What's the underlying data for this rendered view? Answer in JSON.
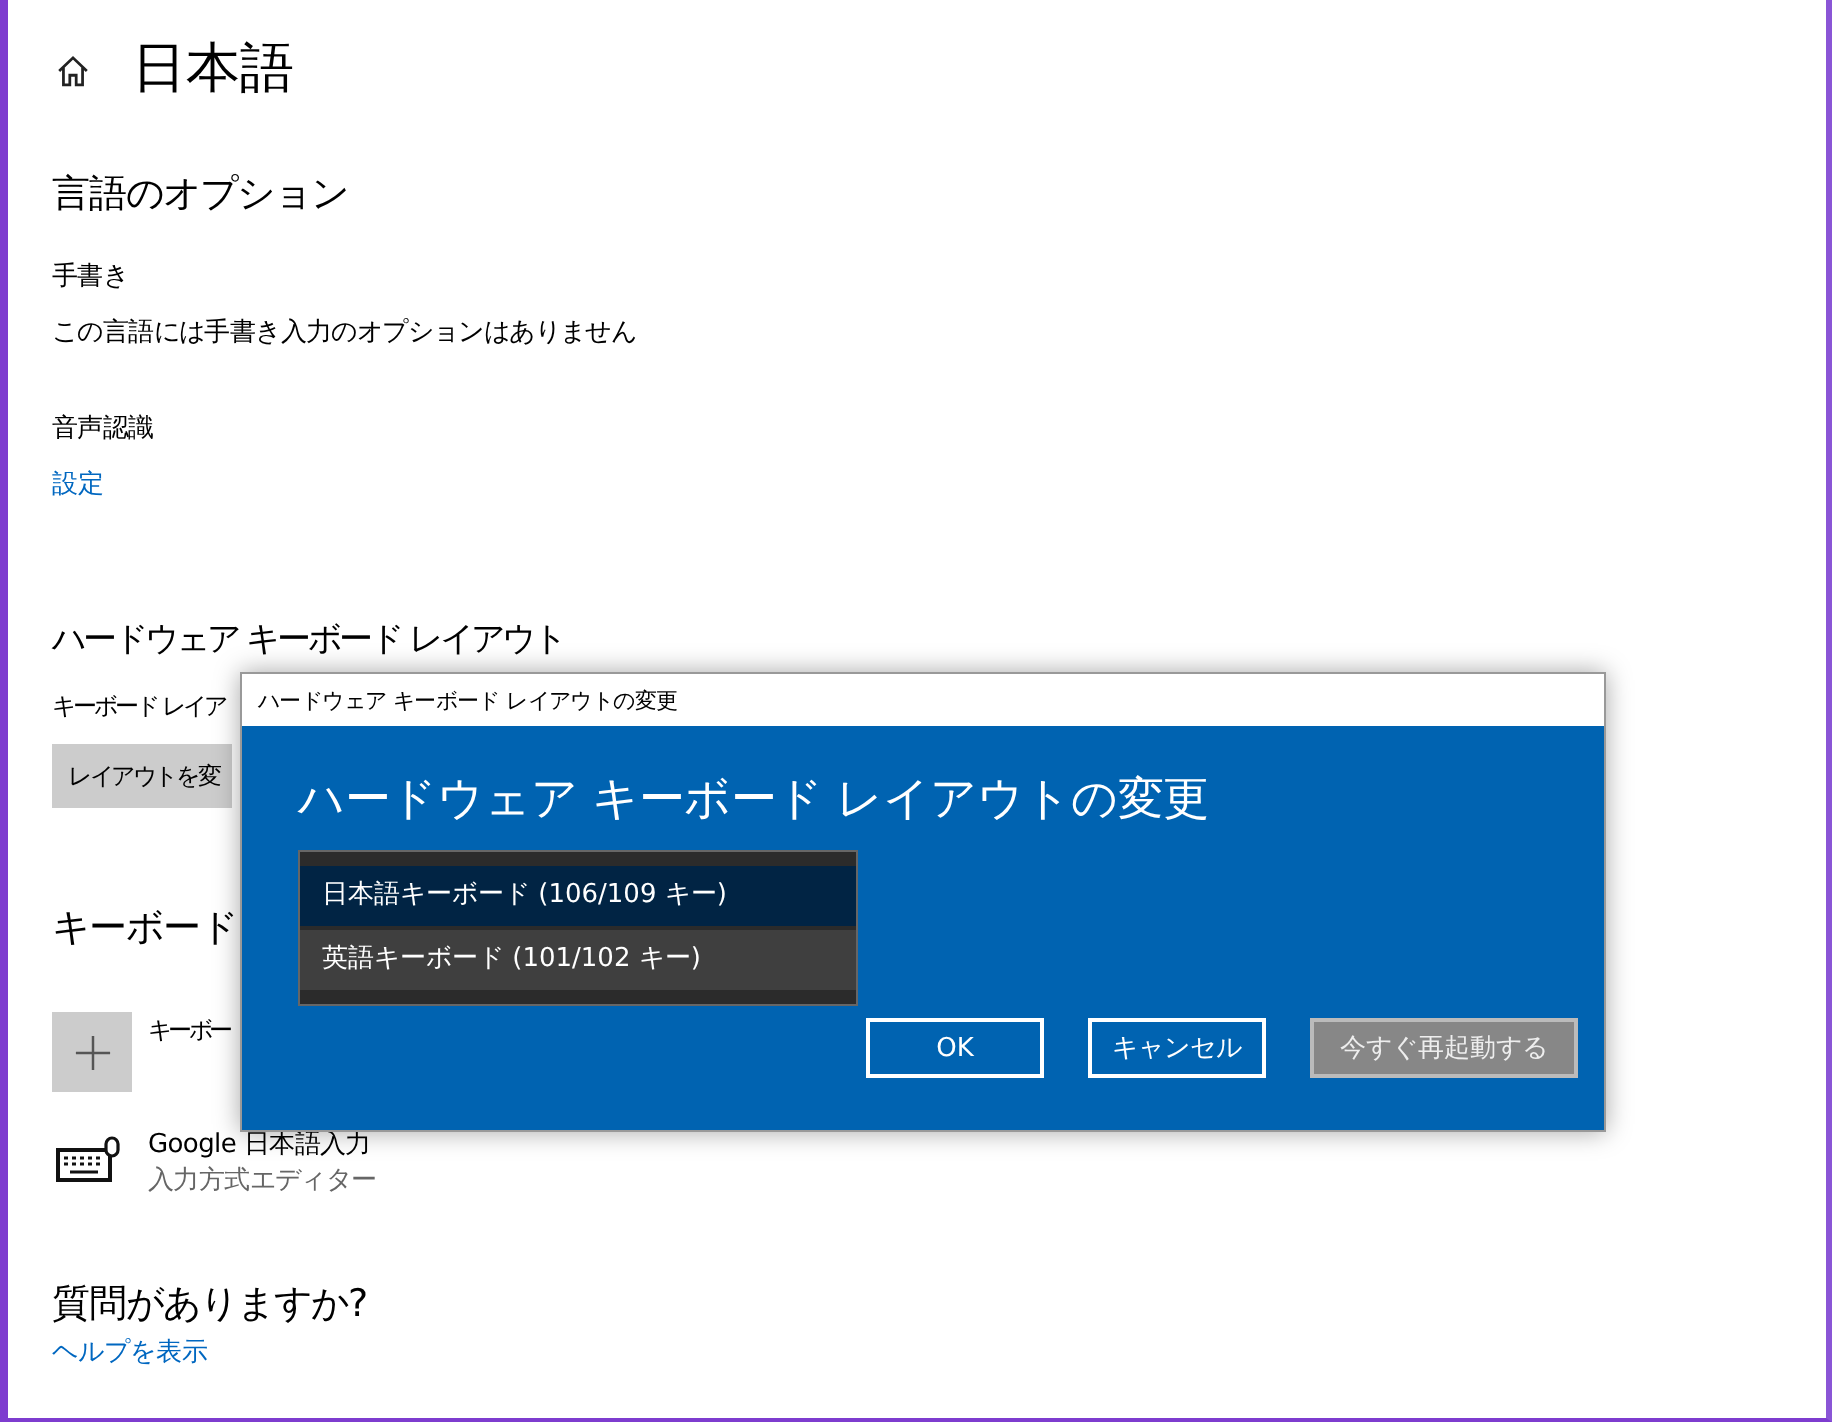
{
  "page": {
    "title": "日本語"
  },
  "language_options": {
    "heading": "言語のオプション",
    "handwriting": {
      "label": "手書き",
      "text": "この言語には手書き入力のオプションはありません"
    },
    "speech": {
      "label": "音声認識",
      "link": "設定"
    }
  },
  "hardware_keyboard": {
    "heading": "ハードウェア キーボード レイアウト",
    "label": "キーボード レイア",
    "button": "レイアウトを変"
  },
  "keyboards": {
    "heading": "キーボード",
    "add_label": "キーボー",
    "items": [
      {
        "name": "Google 日本語入力",
        "subtitle": "入力方式エディター"
      }
    ]
  },
  "help": {
    "heading": "質問がありますか?",
    "link": "ヘルプを表示"
  },
  "dialog": {
    "title": "ハードウェア キーボード レイアウトの変更",
    "heading": "ハードウェア キーボード レイアウトの変更",
    "options": [
      {
        "label": "日本語キーボード (106/109 キー)",
        "selected": true
      },
      {
        "label": "英語キーボード (101/102 キー)",
        "selected": false
      }
    ],
    "buttons": [
      {
        "label": "OK",
        "disabled": false
      },
      {
        "label": "キャンセル",
        "disabled": false
      },
      {
        "label": "今すぐ再起動する",
        "disabled": true
      }
    ]
  }
}
